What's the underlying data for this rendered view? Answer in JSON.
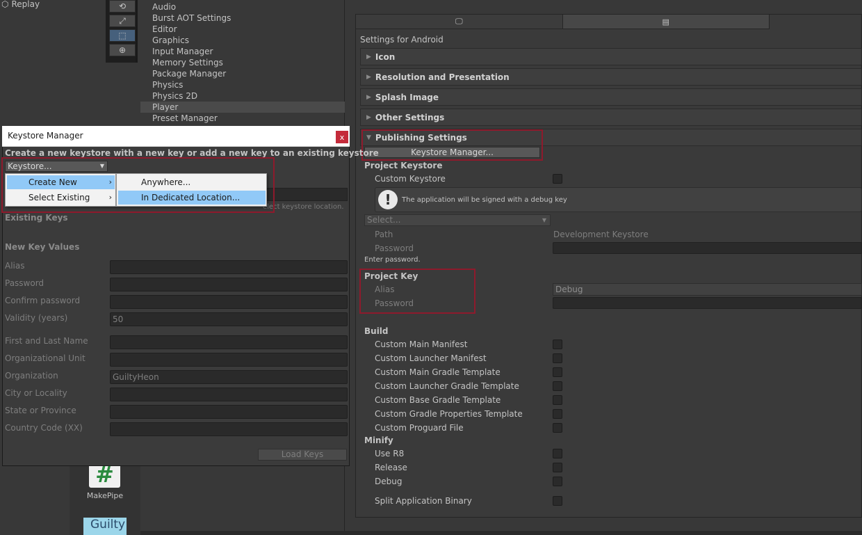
{
  "project": {
    "replay_label": "Replay",
    "makepipe_label": "MakePipe",
    "makepipe_glyph": "#",
    "guilty_label": "Guilty"
  },
  "settings_list": {
    "items": [
      "Audio",
      "Burst AOT Settings",
      "Editor",
      "Graphics",
      "Input Manager",
      "Memory Settings",
      "Package Manager",
      "Physics",
      "Physics 2D",
      "Player",
      "Preset Manager"
    ],
    "selected": "Player"
  },
  "inspector": {
    "settings_for": "Settings for Android",
    "foldouts": {
      "icon": "Icon",
      "resolution": "Resolution and Presentation",
      "splash": "Splash Image",
      "other": "Other Settings",
      "publishing": "Publishing Settings"
    },
    "keystore_manager_button": "Keystore Manager...",
    "project_keystore": {
      "title": "Project Keystore",
      "custom_keystore": "Custom Keystore",
      "info_message": "The application will be signed with a debug key",
      "select_placeholder": "Select...",
      "path_label": "Path",
      "path_value": "Development Keystore",
      "password_label": "Password",
      "enter_password": "Enter password."
    },
    "project_key": {
      "title": "Project Key",
      "alias_label": "Alias",
      "alias_value": "Debug",
      "password_label": "Password"
    },
    "build": {
      "title": "Build",
      "items": [
        "Custom Main Manifest",
        "Custom Launcher Manifest",
        "Custom Main Gradle Template",
        "Custom Launcher Gradle Template",
        "Custom Base Gradle Template",
        "Custom Gradle Properties Template",
        "Custom Proguard File"
      ]
    },
    "minify": {
      "title": "Minify",
      "items": [
        "Use R8",
        "Release",
        "Debug"
      ]
    },
    "split_binary": "Split Application Binary"
  },
  "dialog": {
    "title": "Keystore Manager",
    "close": "x",
    "description": "Create a new keystore with a new key or add a new key to an existing keystore",
    "dropdown": "Keystore...",
    "hint": "elect keystore location.",
    "existing_keys": "Existing Keys",
    "new_key_values": "New Key Values",
    "fields": {
      "alias": "Alias",
      "password": "Password",
      "confirm_password": "Confirm password",
      "validity": "Validity (years)",
      "validity_value": "50",
      "first_last": "First and Last Name",
      "org_unit": "Organizational Unit",
      "organization": "Organization",
      "organization_value": "GuiltyHeon",
      "city": "City or Locality",
      "state": "State or Province",
      "country": "Country Code (XX)"
    },
    "load_keys": "Load Keys"
  },
  "menu": {
    "create_new": "Create New",
    "select_existing": "Select Existing",
    "anywhere": "Anywhere...",
    "dedicated": "In Dedicated Location..."
  },
  "colors": {
    "highlight_box": "#8e1a2c",
    "menu_highlight": "#91c9f7"
  }
}
